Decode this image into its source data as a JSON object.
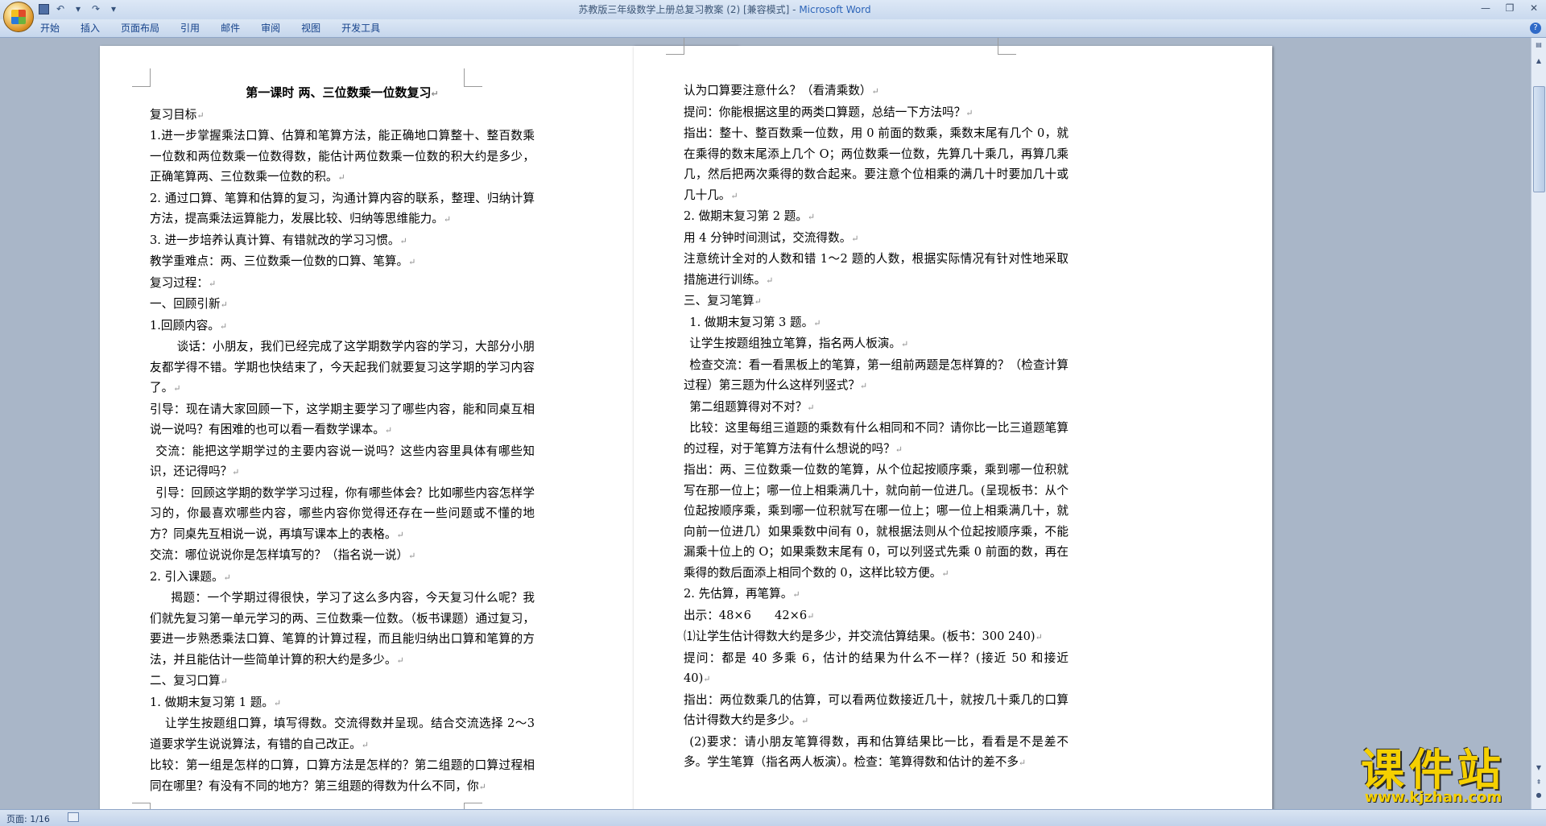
{
  "window": {
    "title": "苏教版三年级数学上册总复习教案 (2) [兼容模式] - ",
    "app_name": "Microsoft Word"
  },
  "ribbon": {
    "tabs": [
      "开始",
      "插入",
      "页面布局",
      "引用",
      "邮件",
      "审阅",
      "视图",
      "开发工具"
    ]
  },
  "status": {
    "page": "页面: 1/16"
  },
  "watermark": {
    "text": "课件站",
    "url": "www.kjzhan.com"
  },
  "page1": {
    "paragraphs": [
      {
        "text": "第一课时 两、三位数乘一位数复习",
        "style": "title"
      },
      {
        "text": "复习目标"
      },
      {
        "text": "1.进一步掌握乘法口算、估算和笔算方法，能正确地口算整十、整百数乘一位数和两位数乘一位数得数，能估计两位数乘一位数的积大约是多少，正确笔算两、三位数乘一位数的积。"
      },
      {
        "text": "2. 通过口算、笔算和估算的复习，沟通计算内容的联系，整理、归纳计算方法，提高乘法运算能力，发展比较、归纳等思维能力。"
      },
      {
        "text": "3. 进一步培养认真计算、有错就改的学习习惯。"
      },
      {
        "text": "教学重难点：两、三位数乘一位数的口算、笔算。"
      },
      {
        "text": "复习过程："
      },
      {
        "text": "一、回顾引新"
      },
      {
        "text": "1.回顾内容。"
      },
      {
        "text": "谈话：小朋友，我们已经完成了这学期数学内容的学习，大部分小朋友都学得不错。学期也快结束了，今天起我们就要复习这学期的学习内容了。",
        "indent": "2.3em"
      },
      {
        "text": "引导：现在请大家回顾一下，这学期主要学习了哪些内容，能和同桌互相说一说吗？有困难的也可以看一看数学课本。"
      },
      {
        "text": "交流：能把这学期学过的主要内容说一说吗？这些内容里具体有哪些知识，还记得吗？",
        "indent": "0.5em"
      },
      {
        "text": "引导：回顾这学期的数学学习过程，你有哪些体会？比如哪些内容怎样学习的，你最喜欢哪些内容，哪些内容你觉得还存在一些问题或不懂的地方？同桌先互相说一说，再填写课本上的表格。",
        "indent": "0.5em"
      },
      {
        "text": "交流：哪位说说你是怎样填写的？（指名说一说）"
      },
      {
        "text": "2. 引入课题。"
      },
      {
        "text": "揭题：一个学期过得很快，学习了这么多内容，今天复习什么呢？我们就先复习第一单元学习的两、三位数乘一位数。（板书课题）通过复习，要进一步熟悉乘法口算、笔算的计算过程，而且能归纳出口算和笔算的方法，并且能估计一些简单计算的积大约是多少。",
        "indent": "1.8em"
      },
      {
        "text": "二、复习口算"
      },
      {
        "text": "1. 做期末复习第 1 题。"
      },
      {
        "text": "让学生按题组口算，填写得数。交流得数并呈现。结合交流选择 2～3 道要求学生说说算法，有错的自己改正。",
        "indent": "1.3em"
      },
      {
        "text": "比较：第一组是怎样的口算，口算方法是怎样的？第二组题的口算过程相同在哪里？有没有不同的地方？第三组题的得数为什么不同，你"
      }
    ]
  },
  "page2": {
    "paragraphs": [
      {
        "text": "认为口算要注意什么？（看清乘数）"
      },
      {
        "text": "提问：你能根据这里的两类口算题，总结一下方法吗？"
      },
      {
        "text": "指出：整十、整百数乘一位数，用 0 前面的数乘，乘数末尾有几个 0，就在乘得的数末尾添上几个 O；两位数乘一位数，先算几十乘几，再算几乘几，然后把两次乘得的数合起来。要注意个位相乘的满几十时要加几十或几十几。"
      },
      {
        "text": "2. 做期末复习第 2 题。"
      },
      {
        "text": "用 4 分钟时间测试，交流得数。"
      },
      {
        "text": "注意统计全对的人数和错 1～2 题的人数，根据实际情况有针对性地采取措施进行训练。"
      },
      {
        "text": "三、复习笔算"
      },
      {
        "text": "1. 做期末复习第 3 题。",
        "indent": "0.5em"
      },
      {
        "text": "让学生按题组独立笔算，指名两人板演。",
        "indent": "0.5em"
      },
      {
        "text": "检查交流：看一看黑板上的笔算，第一组前两题是怎样算的？（检查计算过程）第三题为什么这样列竖式？",
        "indent": "0.5em"
      },
      {
        "text": "第二组题算得对不对？",
        "indent": "0.5em"
      },
      {
        "text": "比较：这里每组三道题的乘数有什么相同和不同？请你比一比三道题笔算的过程，对于笔算方法有什么想说的吗？",
        "indent": "0.5em"
      },
      {
        "text": "指出：两、三位数乘一位数的笔算，从个位起按顺序乘，乘到哪一位积就写在那一位上；哪一位上相乘满几十，就向前一位进几。(呈现板书：从个位起按顺序乘，乘到哪一位积就写在哪一位上；哪一位上相乘满几十，就向前一位进几）如果乘数中间有 0，就根据法则从个位起按顺序乘，不能漏乘十位上的 O；如果乘数末尾有 0，可以列竖式先乘 0 前面的数，再在乘得的数后面添上相同个数的 0，这样比较方便。"
      },
      {
        "text": "2. 先估算，再笔算。"
      },
      {
        "text": "出示：48×6　　42×6"
      },
      {
        "text": "⑴让学生估计得数大约是多少，并交流估算结果。(板书：300 240)"
      },
      {
        "text": "提问：都是 40 多乘 6，估计的结果为什么不一样？(接近 50 和接近 40)"
      },
      {
        "text": "指出：两位数乘几的估算，可以看两位数接近几十，就按几十乘几的口算估计得数大约是多少。"
      },
      {
        "text": "(2)要求：请小朋友笔算得数，再和估算结果比一比，看看是不是差不多。学生笔算（指名两人板演）。检查：笔算得数和估计的差不多",
        "indent": "0.5em"
      }
    ]
  }
}
